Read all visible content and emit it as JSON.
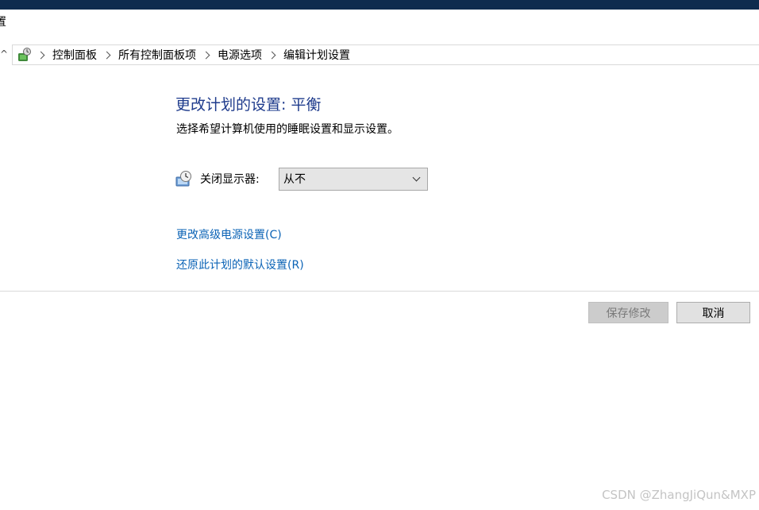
{
  "window": {
    "title_fragment": "置"
  },
  "breadcrumb": {
    "items": [
      "控制面板",
      "所有控制面板项",
      "电源选项",
      "编辑计划设置"
    ]
  },
  "main": {
    "title": "更改计划的设置: 平衡",
    "subtitle": "选择希望计算机使用的睡眠设置和显示设置。",
    "display_off": {
      "label": "关闭显示器:",
      "value": "从不"
    },
    "links": {
      "advanced": "更改高级电源设置(C)",
      "restore": "还原此计划的默认设置(R)"
    }
  },
  "buttons": {
    "save": "保存修改",
    "cancel": "取消"
  },
  "watermark": "CSDN @ZhangJiQun&MXP",
  "colors": {
    "title": "#1e3b8c",
    "link": "#0b63b6",
    "taskbar": "#0f2b4e"
  },
  "icons": {
    "breadcrumb_root": "control-panel-icon",
    "display": "monitor-clock-icon"
  }
}
